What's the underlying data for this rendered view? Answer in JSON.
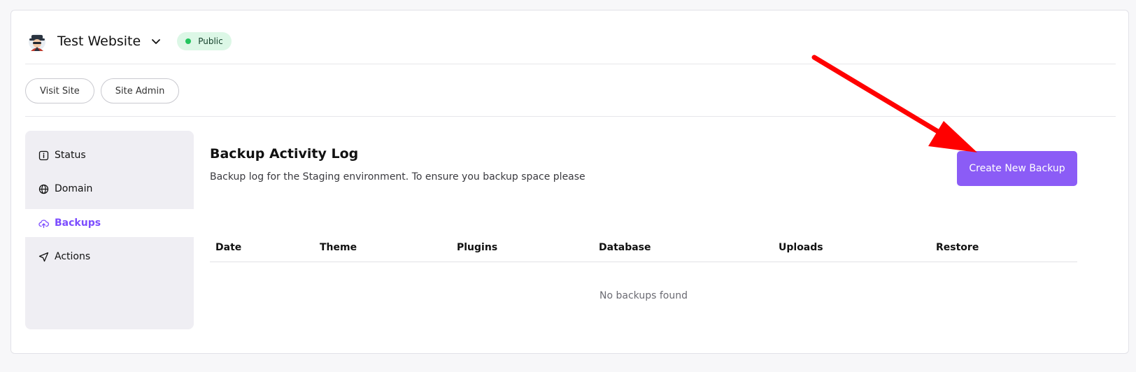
{
  "header": {
    "site_name": "Test Website",
    "status_badge": "Public",
    "status_color": "#22c55e",
    "logo_icon": "spy-avatar-icon",
    "dropdown_icon": "chevron-down-icon"
  },
  "quick_links": {
    "visit_site": "Visit Site",
    "site_admin": "Site Admin"
  },
  "sidebar": {
    "items": [
      {
        "label": "Status",
        "icon": "info-icon",
        "active": false
      },
      {
        "label": "Domain",
        "icon": "globe-icon",
        "active": false
      },
      {
        "label": "Backups",
        "icon": "cloud-upload-icon",
        "active": true
      },
      {
        "label": "Actions",
        "icon": "send-icon",
        "active": false
      }
    ]
  },
  "main": {
    "title": "Backup Activity Log",
    "description": "Backup log for the Staging environment. To ensure you backup space please",
    "create_button": "Create New Backup",
    "accent_color": "#8b5cf6",
    "table": {
      "columns": [
        "Date",
        "Theme",
        "Plugins",
        "Database",
        "Uploads",
        "Restore"
      ],
      "rows": [],
      "empty_message": "No backups found"
    }
  },
  "annotation": {
    "color": "#ff0000",
    "type": "arrow pointing to create button"
  }
}
